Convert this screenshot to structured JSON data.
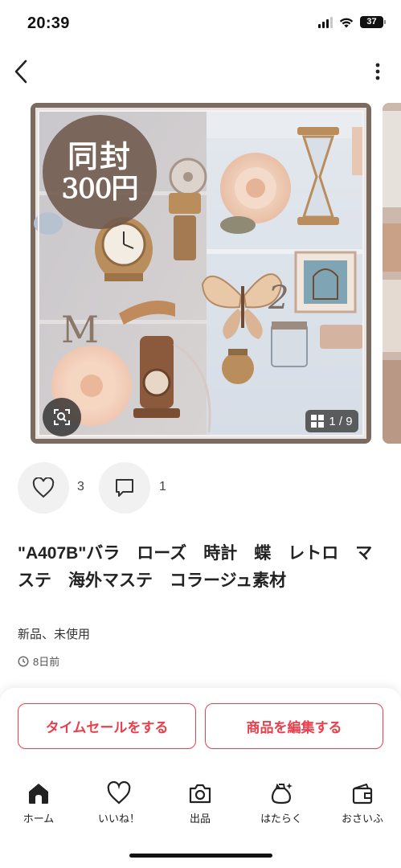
{
  "status_bar": {
    "time": "20:39",
    "battery": "37"
  },
  "nav": {
    "back_icon": "chevron-left-icon",
    "more_icon": "more-vertical-icon"
  },
  "gallery": {
    "badge_line1": "同封",
    "badge_line2": "300円",
    "counter": "1 / 9",
    "search_icon": "image-search-icon"
  },
  "reactions": {
    "likes": "3",
    "comments": "1"
  },
  "item": {
    "title": "\"A407B\"バラ　ローズ　時計　蝶　レトロ　マステ　海外マステ　コラージュ素材",
    "condition": "新品、未使用",
    "posted": "8日前"
  },
  "actions": {
    "time_sale": "タイムセールをする",
    "edit_item": "商品を編集する"
  },
  "tabs": [
    {
      "label": "ホーム",
      "icon": "home-icon"
    },
    {
      "label": "いいね！",
      "icon": "heart-icon"
    },
    {
      "label": "出品",
      "icon": "camera-icon"
    },
    {
      "label": "はたらく",
      "icon": "money-bag-icon"
    },
    {
      "label": "おさいふ",
      "icon": "wallet-icon"
    }
  ],
  "colors": {
    "accent": "#e8404c",
    "background": "#ffffff"
  }
}
